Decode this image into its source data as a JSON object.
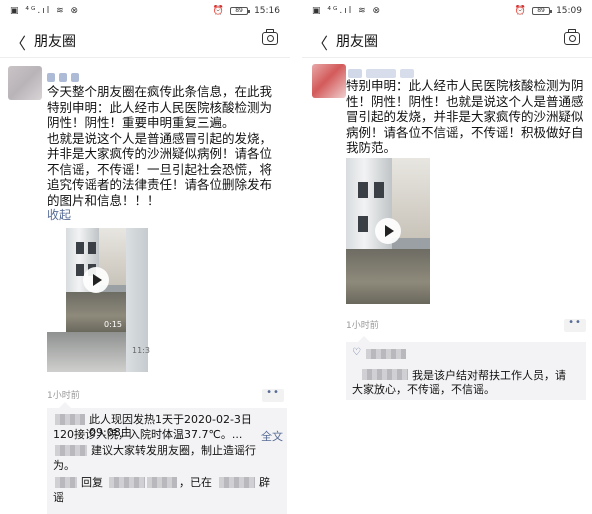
{
  "left": {
    "status": {
      "icons": "▣ ⁴ᴳ.ıl ≋ ⊗",
      "alarm": "⏰",
      "battery": "89",
      "time": "15:16"
    },
    "nav": {
      "back": "〈",
      "title": "朋友圈"
    },
    "post": {
      "text": "今天整个朋友圈在疯传此条信息，在此我特别申明：此人经市人民医院核酸检测为阴性！阴性！重要申明重复三遍。\n也就是说这个人是普通感冒引起的发烧，并非是大家疯传的沙洲疑似病例！请各位不信谣，不传谣！一旦引起社会恐慌，将追究传谣者的法律责任！请各位删除发布的图片和信息！！！",
      "collapse": "收起",
      "video_duration": "0:15",
      "strip_time": "11:3",
      "timestamp": "1小时前",
      "more": "••"
    },
    "comments": {
      "c1_part1": "此人现因发热1天于2020-02-3日 09:08由",
      "c1_part2": "120接诊入院，入院时体温37.7℃。...",
      "full_text": "全文",
      "c2_part1": "建议大家转发朋友圈，制止造谣行",
      "c2_part2": "为。",
      "c3_part1": "回复",
      "c3_part2": "，已在",
      "c3_part3": "辟",
      "c3_part4": "谣"
    }
  },
  "right": {
    "status": {
      "icons": "▣ ⁴ᴳ.ıl ≋ ⊗",
      "alarm": "⏰",
      "battery": "89",
      "time": "15:09"
    },
    "nav": {
      "back": "〈",
      "title": "朋友圈"
    },
    "post": {
      "text": "特别申明：此人经市人民医院核酸检测为阴性！阴性！阴性！也就是说这个人是普通感冒引起的发烧，并非是大家疯传的沙洲疑似病例！请各位不信谣，不传谣！积极做好自我防范。",
      "timestamp": "1小时前",
      "more": "••"
    },
    "comments": {
      "heart": "♡",
      "c1_part1": "我是该户结对帮扶工作人员，请",
      "c1_part2": "大家放心，不传谣，不信谣。"
    }
  },
  "colors": {
    "link": "#576b95",
    "comment_bg": "#f3f3f5",
    "timestamp": "#999999"
  }
}
